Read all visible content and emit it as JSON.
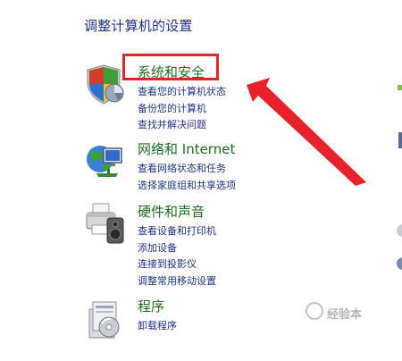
{
  "page": {
    "title": "调整计算机的设置"
  },
  "categories": [
    {
      "title": "系统和安全",
      "icon": "shield-icon",
      "links": [
        "查看您的计算机状态",
        "备份您的计算机",
        "查找并解决问题"
      ]
    },
    {
      "title": "网络和 Internet",
      "icon": "network-globe-icon",
      "links": [
        "查看网络状态和任务",
        "选择家庭组和共享选项"
      ]
    },
    {
      "title": "硬件和声音",
      "icon": "printer-speaker-icon",
      "links": [
        "查看设备和打印机",
        "添加设备",
        "连接到投影仪",
        "调整常用移动设置"
      ]
    },
    {
      "title": "程序",
      "icon": "programs-icon",
      "links": [
        "卸载程序"
      ]
    }
  ],
  "annotation": {
    "highlight_color": "#e8222a",
    "arrow_color": "#e8222a"
  },
  "watermark": {
    "text": "经验本"
  },
  "colors": {
    "link": "#1e3287",
    "category_title": "#1e6e1e"
  }
}
